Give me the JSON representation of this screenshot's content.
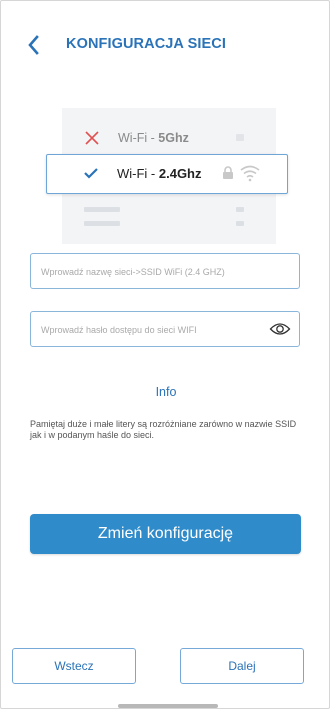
{
  "header": {
    "title": "KONFIGURACJA SIECI"
  },
  "networks": {
    "unselected": {
      "prefix": "Wi-Fi - ",
      "band": "5Ghz"
    },
    "selected": {
      "prefix": "Wi-Fi - ",
      "band": "2.4Ghz"
    }
  },
  "form": {
    "ssid_placeholder": "Wprowadź nazwę sieci->SSID WiFi (2.4 GHZ)",
    "ssid_value": "",
    "password_placeholder": "Wprowadź hasło dostępu do sieci WIFI",
    "password_value": ""
  },
  "info_link": "Info",
  "note": "Pamiętaj duże i małe litery są rozróżniane zarówno w nazwie SSID jak i w podanym haśle do sieci.",
  "buttons": {
    "change_config": "Zmień konfigurację",
    "back": "Wstecz",
    "next": "Dalej"
  },
  "colors": {
    "accent": "#2a73b8",
    "primary_button": "#2f8bc9",
    "error_x": "#e05252"
  },
  "icons": [
    "back-arrow-icon",
    "close-x-icon",
    "check-icon",
    "lock-icon",
    "wifi-icon",
    "eye-icon"
  ]
}
